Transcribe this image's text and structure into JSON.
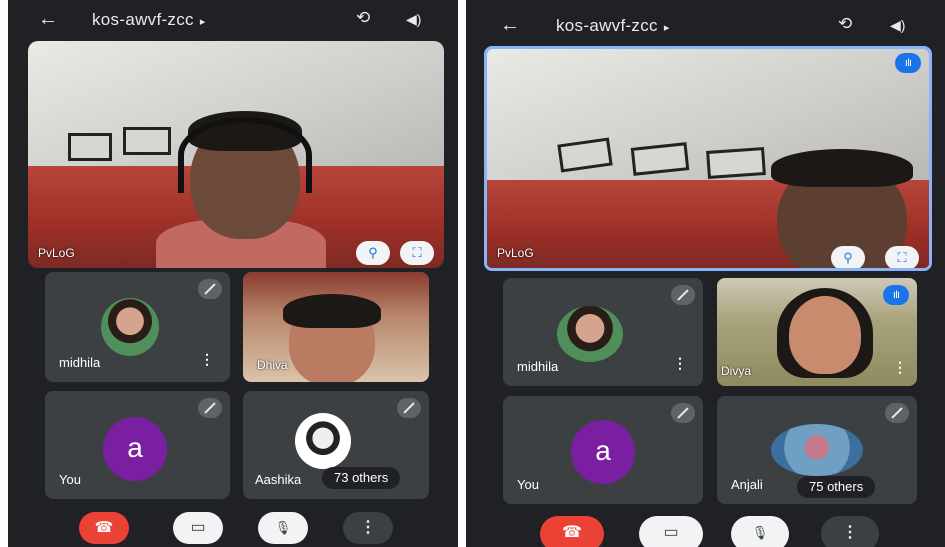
{
  "screens": [
    {
      "meeting_code": "kos-awvf-zcc",
      "main_tile": {
        "name": "PvLoG"
      },
      "tiles": [
        {
          "name": "midhila"
        },
        {
          "name": "Dhiva"
        },
        {
          "name": "You",
          "avatar_letter": "a"
        },
        {
          "name": "Aashika",
          "others_label": "73 others"
        }
      ]
    },
    {
      "meeting_code": "kos-awvf-zcc",
      "main_tile": {
        "name": "PvLoG"
      },
      "tiles": [
        {
          "name": "midhila"
        },
        {
          "name": "Divya"
        },
        {
          "name": "You",
          "avatar_letter": "a"
        },
        {
          "name": "Anjali",
          "others_label": "75 others"
        }
      ]
    }
  ],
  "icons": {
    "back": "←",
    "caret": "▸",
    "switch_camera": "⟲",
    "speaker": "◀)",
    "pin": "⚲",
    "fullscreen": "⛶",
    "mic_off": "🎙",
    "more": "⋮",
    "end_call": "☎",
    "camera_off": "▭",
    "speaking": "ıIı"
  },
  "colors": {
    "background": "#202124",
    "tile": "#3c4043",
    "end_call": "#ea4335",
    "accent": "#1a73e8",
    "avatar": "#7b1fa2"
  }
}
